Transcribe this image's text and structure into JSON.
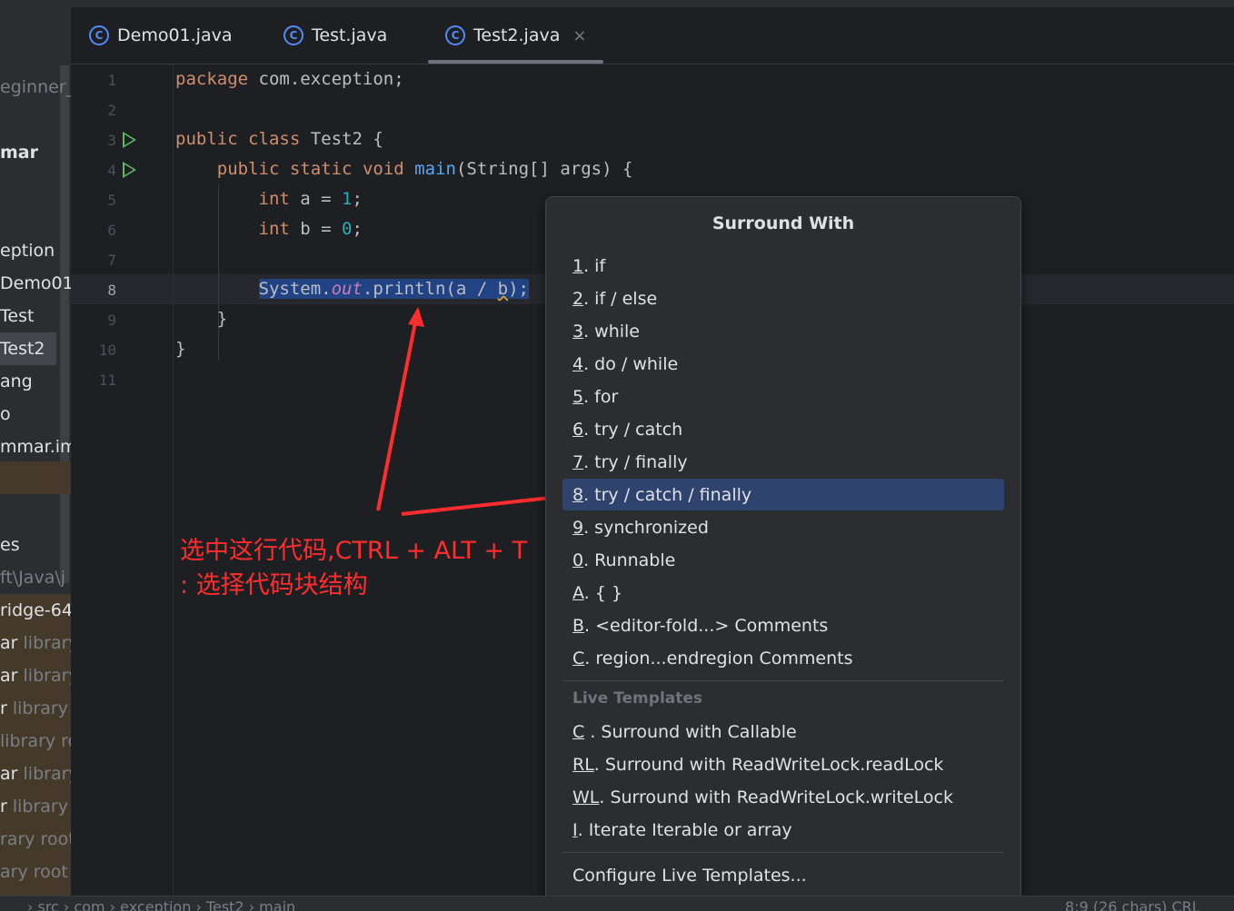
{
  "tabs": [
    {
      "label": "Demo01.java",
      "icon": "class-icon"
    },
    {
      "label": "Test.java",
      "icon": "class-icon"
    },
    {
      "label": "Test2.java",
      "icon": "class-icon",
      "active": true,
      "close": "×"
    }
  ],
  "sidebar": {
    "items": [
      {
        "text": "eginner_("
      },
      {
        "text": "mar"
      },
      {
        "text": "eption"
      },
      {
        "text": "Demo01"
      },
      {
        "text": "Test"
      },
      {
        "text": "Test2"
      },
      {
        "text": "ang"
      },
      {
        "text": "o"
      },
      {
        "text": "mmar.im"
      },
      {
        "text": "es"
      },
      {
        "text": "ft\\Java\\j"
      },
      {
        "text": "ridge-64"
      },
      {
        "text": "ar",
        "lib": "library"
      },
      {
        "text": "ar",
        "lib": "library"
      },
      {
        "text": "r",
        "lib": "library r"
      },
      {
        "text": "",
        "lib": "library ro"
      },
      {
        "text": "ar",
        "lib": "library"
      },
      {
        "text": "r",
        "lib": "library r"
      },
      {
        "text": "",
        "lib": "rary root"
      },
      {
        "text": "",
        "lib": "ary root"
      }
    ]
  },
  "editor": {
    "line_numbers": [
      "1",
      "2",
      "3",
      "4",
      "5",
      "6",
      "7",
      "8",
      "9",
      "10",
      "11"
    ],
    "current_line": "8",
    "code": {
      "l1_kw": "package",
      "l1_rest": " com.exception;",
      "l3_kw1": "public",
      "l3_kw2": "class",
      "l3_rest": " Test2 {",
      "l4_kw1": "public",
      "l4_kw2": "static",
      "l4_kw3": "void",
      "l4_fn": "main",
      "l4_rest": "(String[] args) {",
      "l5_kw": "int",
      "l5_a": " a = ",
      "l5_num": "1",
      "l5_end": ";",
      "l6_kw": "int",
      "l6_a": " b = ",
      "l6_num": "0",
      "l6_end": ";",
      "l8_a": "System.",
      "l8_fld": "out",
      "l8_b": ".println(a / ",
      "l8_c": "b",
      "l8_d": ");",
      "l9": "}",
      "l10": "}"
    }
  },
  "popup": {
    "title": "Surround With",
    "items": [
      {
        "key": "1",
        "label": ". if"
      },
      {
        "key": "2",
        "label": ". if / else"
      },
      {
        "key": "3",
        "label": ". while"
      },
      {
        "key": "4",
        "label": ". do / while"
      },
      {
        "key": "5",
        "label": ". for"
      },
      {
        "key": "6",
        "label": ". try / catch"
      },
      {
        "key": "7",
        "label": ". try / finally"
      },
      {
        "key": "8",
        "label": ". try / catch / finally"
      },
      {
        "key": "9",
        "label": ". synchronized"
      },
      {
        "key": "0",
        "label": ". Runnable"
      },
      {
        "key": "A",
        "label": ". { }"
      },
      {
        "key": "B",
        "label": ". <editor-fold...> Comments"
      },
      {
        "key": "C",
        "label": ". region...endregion Comments"
      }
    ],
    "selected_index": 7,
    "live_templates_title": "Live Templates",
    "live_templates": [
      {
        "key": "C",
        "label": " . Surround with Callable"
      },
      {
        "key": "RL",
        "label": ". Surround with ReadWriteLock.readLock"
      },
      {
        "key": "WL",
        "label": ". Surround with ReadWriteLock.writeLock"
      },
      {
        "key": "I",
        "label": ". Iterate Iterable or array"
      }
    ],
    "configure": "Configure Live Templates..."
  },
  "annotation": {
    "line1": "选中这行代码,CTRL + ALT + T",
    "line2": ": 选择代码块结构",
    "color": "#ff2d2d"
  },
  "statusbar": {
    "breadcrumb": "› src › com › exception › Test2 › main",
    "right": "8:9 (26 chars)   CRL"
  },
  "colors": {
    "keyword": "#cf8e6d",
    "function": "#56a8f5",
    "number": "#2aacb8",
    "field": "#c77dbb",
    "selection": "#214283",
    "popup_selected": "#2e436e"
  }
}
